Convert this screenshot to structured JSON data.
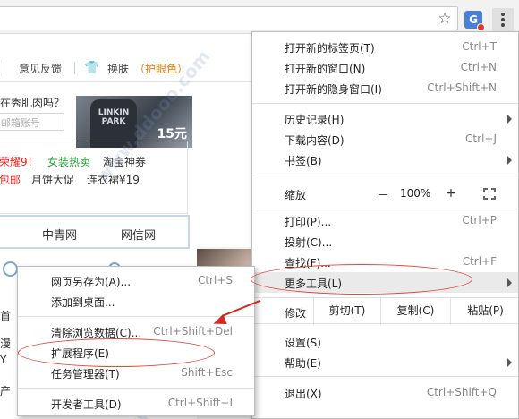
{
  "toolbar": {
    "bookmark_icon": "star-icon",
    "extension_icon_letter": "G",
    "menu_icon": "kebab-menu-icon"
  },
  "page": {
    "topnav": {
      "feedback": "意见反馈",
      "skin": "换肤",
      "eye_mode": "（护眼色）"
    },
    "question": "在秀肌肉吗？",
    "account_placeholder": "邮箱账号",
    "ad": {
      "shirt_text": "LINKIN PARK",
      "price": "15元"
    },
    "hot": {
      "row1": [
        "荣耀9！",
        "女装热卖",
        "淘宝神券"
      ],
      "row2": [
        "包邮",
        "月饼大促",
        "连衣裙¥19"
      ]
    },
    "news": [
      "中青网",
      "网信网"
    ],
    "side_chars": [
      "首",
      "漫",
      "Y",
      "产"
    ],
    "colors": {
      "red": "#e0281c",
      "green": "#28a338",
      "orange": "#f07b10",
      "annotation": "#d42a20"
    }
  },
  "main_menu": {
    "items": [
      {
        "label": "打开新的标签页(T)",
        "shortcut": "Ctrl+T"
      },
      {
        "label": "打开新的窗口(N)",
        "shortcut": "Ctrl+N"
      },
      {
        "label": "打开新的隐身窗口(I)",
        "shortcut": "Ctrl+Shift+N"
      },
      {
        "label": "历史记录(H)",
        "shortcut": ""
      },
      {
        "label": "下载内容(D)",
        "shortcut": "Ctrl+J"
      },
      {
        "label": "书签(B)",
        "shortcut": ""
      },
      {
        "label": "打印(P)...",
        "shortcut": "Ctrl+P"
      },
      {
        "label": "投射(C)...",
        "shortcut": ""
      },
      {
        "label": "查找(F)...",
        "shortcut": "Ctrl+F"
      },
      {
        "label": "更多工具(L)",
        "shortcut": ""
      },
      {
        "label": "设置(S)",
        "shortcut": ""
      },
      {
        "label": "帮助(E)",
        "shortcut": ""
      },
      {
        "label": "退出(X)",
        "shortcut": "Ctrl+Shift+Q"
      }
    ],
    "zoom": {
      "label": "缩放",
      "minus": "－",
      "value": "100%",
      "plus": "+"
    },
    "edit": {
      "label": "修改",
      "cut": "剪切(T)",
      "copy": "复制(C)",
      "paste": "粘贴(P)"
    }
  },
  "sub_menu": {
    "items": [
      {
        "label": "网页另存为(A)...",
        "shortcut": "Ctrl+S"
      },
      {
        "label": "添加到桌面...",
        "shortcut": ""
      },
      {
        "label": "清除浏览数据(C)...",
        "shortcut": "Ctrl+Shift+Del"
      },
      {
        "label": "扩展程序(E)",
        "shortcut": ""
      },
      {
        "label": "任务管理器(T)",
        "shortcut": "Shift+Esc"
      },
      {
        "label": "开发者工具(D)",
        "shortcut": "Ctrl+Shift+I"
      }
    ]
  },
  "watermark": {
    "text1": "多多软件站",
    "text2": "www.ddooo.com"
  }
}
